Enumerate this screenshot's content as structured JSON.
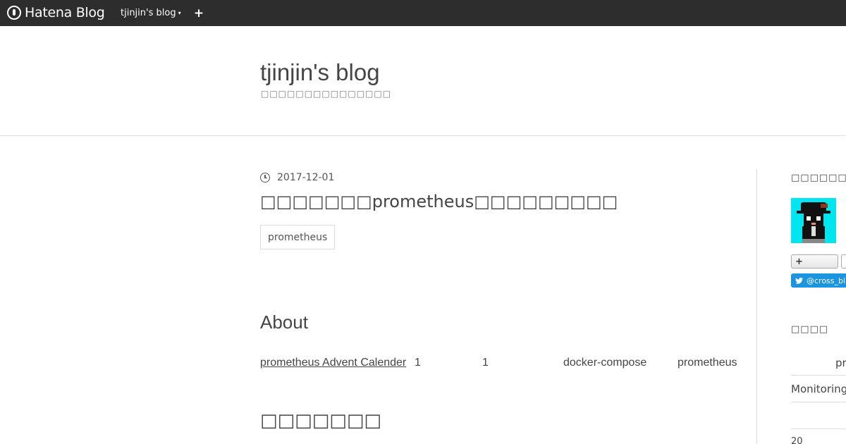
{
  "topbar": {
    "logo_text": "Hatena Blog",
    "blog_menu_label": "tjinjin's blog",
    "blog_menu_caret": "▾",
    "add_label": "+"
  },
  "header": {
    "title": "tjinjin's blog",
    "description": "□□□□□□□□□□□□□□□"
  },
  "entry": {
    "date": "2017-12-01",
    "title": "□□□□□□□prometheus□□□□□□□□□",
    "category": "prometheus",
    "about_heading": "About",
    "about_link": "prometheus Advent Calender",
    "about_segments": [
      "1",
      "1",
      "docker-compose",
      "prometheus"
    ],
    "section_heading": "□□□□□□□"
  },
  "sidebar": {
    "profile_title": "□□□□□□",
    "follow_label": "+",
    "twitter_label": "@cross_bl",
    "search_title": "□□□□",
    "categories": [
      "pr",
      "Monitoring",
      ""
    ],
    "archive_label": "20"
  },
  "colors": {
    "topbar_bg": "#2d2d2d",
    "avatar_bg": "#00e6f0",
    "twitter_blue": "#1b95e0"
  }
}
